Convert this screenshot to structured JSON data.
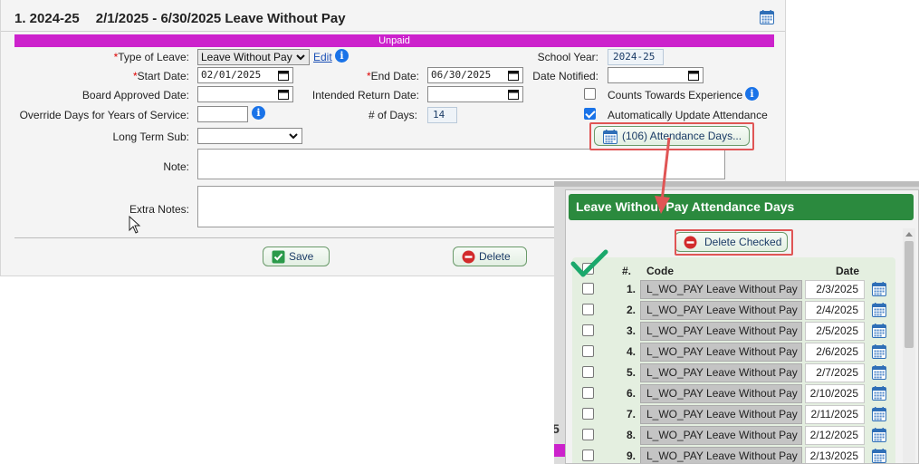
{
  "form": {
    "title_index": "1. 2024-25",
    "title_range": "2/1/2025 - 6/30/2025 Leave Without Pay",
    "status_bar": "Unpaid",
    "type_of_leave_label": "Type of Leave:",
    "type_of_leave_value": "Leave Without Pay",
    "edit_link": "Edit",
    "school_year_label": "School Year:",
    "school_year_value": "2024-25",
    "start_date_label": "Start Date:",
    "start_date_value": "02/01/2025",
    "end_date_label": "End Date:",
    "end_date_value": "06/30/2025",
    "date_notified_label": "Date Notified:",
    "board_approved_label": "Board Approved Date:",
    "intended_return_label": "Intended Return Date:",
    "counts_experience_label": "Counts Towards Experience",
    "override_days_label": "Override Days for Years of Service:",
    "num_days_label": "# of Days:",
    "num_days_value": "14",
    "auto_update_label": "Automatically Update Attendance",
    "long_term_sub_label": "Long Term Sub:",
    "attendance_days_button": "(106) Attendance Days...",
    "note_label": "Note:",
    "extra_notes_label": "Extra Notes:",
    "save_button": "Save",
    "delete_button": "Delete"
  },
  "popup": {
    "title": "Leave Without Pay Attendance Days",
    "delete_checked_button": "Delete Checked",
    "headers": {
      "num": "#.",
      "code": "Code",
      "date": "Date"
    },
    "rows": [
      {
        "num": "1.",
        "code": "L_WO_PAY Leave Without Pay",
        "date": "2/3/2025"
      },
      {
        "num": "2.",
        "code": "L_WO_PAY Leave Without Pay",
        "date": "2/4/2025"
      },
      {
        "num": "3.",
        "code": "L_WO_PAY Leave Without Pay",
        "date": "2/5/2025"
      },
      {
        "num": "4.",
        "code": "L_WO_PAY Leave Without Pay",
        "date": "2/6/2025"
      },
      {
        "num": "5.",
        "code": "L_WO_PAY Leave Without Pay",
        "date": "2/7/2025"
      },
      {
        "num": "6.",
        "code": "L_WO_PAY Leave Without Pay",
        "date": "2/10/2025"
      },
      {
        "num": "7.",
        "code": "L_WO_PAY Leave Without Pay",
        "date": "2/11/2025"
      },
      {
        "num": "8.",
        "code": "L_WO_PAY Leave Without Pay",
        "date": "2/12/2025"
      },
      {
        "num": "9.",
        "code": "L_WO_PAY Leave Without Pay",
        "date": "2/13/2025"
      }
    ]
  },
  "colors": {
    "status_bar": "#cc22cc",
    "popup_header": "#2b8a3e",
    "highlight": "#e05555",
    "checkmark_annotation": "#1aa86b"
  },
  "icons": [
    "calendar-icon",
    "info-icon",
    "chevron-down-icon",
    "checkbox-icon",
    "no-entry-icon",
    "arrow-annotation",
    "checkmark-annotation",
    "mouse-cursor-icon"
  ]
}
